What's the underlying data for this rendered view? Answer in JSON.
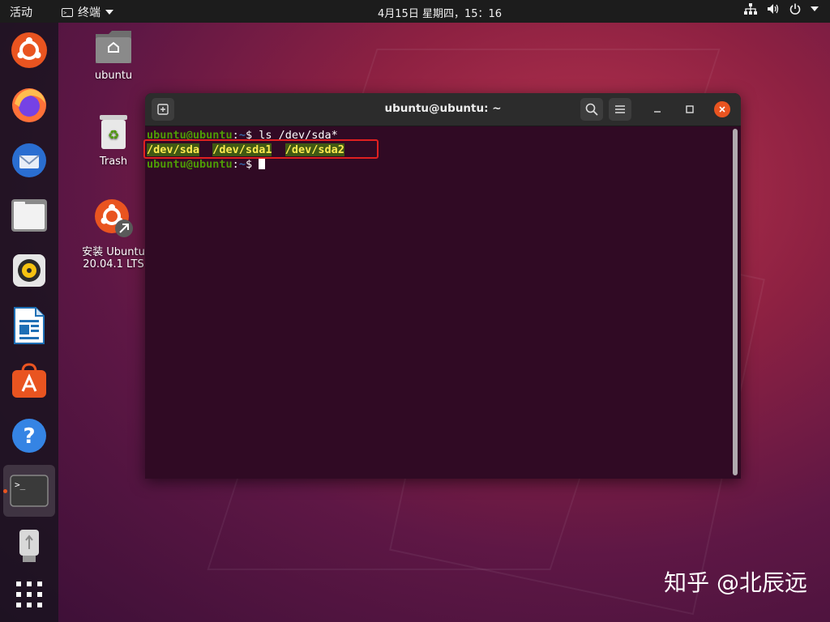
{
  "topbar": {
    "activities": "活动",
    "app_name": "终端",
    "clock": "4月15日 星期四，15：16"
  },
  "dock": {
    "items": [
      {
        "name": "ubuntu-installer-icon"
      },
      {
        "name": "firefox-icon"
      },
      {
        "name": "thunderbird-icon"
      },
      {
        "name": "files-icon"
      },
      {
        "name": "rhythmbox-icon"
      },
      {
        "name": "libreoffice-writer-icon"
      },
      {
        "name": "ubuntu-software-icon"
      },
      {
        "name": "help-icon"
      },
      {
        "name": "terminal-icon",
        "active": true
      },
      {
        "name": "usb-drive-icon"
      },
      {
        "name": "show-applications-icon"
      }
    ]
  },
  "desktop": {
    "home_label": "ubuntu",
    "trash_label": "Trash",
    "installer_label_1": "安装 Ubuntu",
    "installer_label_2": "20.04.1 LTS"
  },
  "terminal": {
    "title": "ubuntu@ubuntu: ~",
    "prompt_user": "ubuntu@ubuntu",
    "prompt_sep": ":",
    "prompt_path": "~",
    "prompt_dollar": "$ ",
    "command": "ls /dev/sda*",
    "output": [
      "/dev/sda",
      "/dev/sda1",
      "/dev/sda2"
    ]
  },
  "watermark": "知乎 @北辰远",
  "colors": {
    "accent": "#e95420",
    "terminal_bg": "#300a24",
    "highlight_box": "#e02020"
  }
}
